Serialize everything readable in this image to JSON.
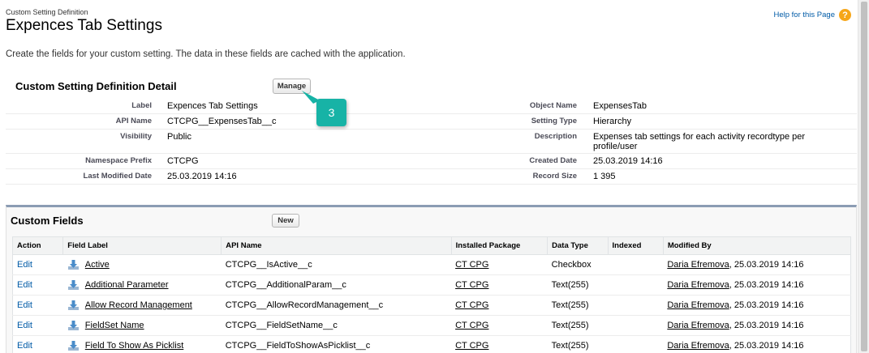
{
  "header": {
    "breadcrumb": "Custom Setting Definition",
    "title": "Expences Tab Settings",
    "help_link": "Help for this Page",
    "help_icon": "question-icon"
  },
  "description": "Create the fields for your custom setting. The data in these fields are cached with the application.",
  "detail": {
    "title": "Custom Setting Definition Detail",
    "manage_label": "Manage",
    "badge": "3",
    "rows": [
      {
        "l1": "Label",
        "v1": "Expences Tab Settings",
        "l2": "Object Name",
        "v2": "ExpensesTab"
      },
      {
        "l1": "API Name",
        "v1": "CTCPG__ExpensesTab__c",
        "l2": "Setting Type",
        "v2": "Hierarchy"
      },
      {
        "l1": "Visibility",
        "v1": "Public",
        "l2": "Description",
        "v2": "Expenses tab settings for each activity recordtype per profile/user"
      },
      {
        "l1": "Namespace Prefix",
        "v1": "CTCPG",
        "l2": "Created Date",
        "v2": "25.03.2019 14:16"
      },
      {
        "l1": "Last Modified Date",
        "v1": "25.03.2019 14:16",
        "l2": "Record Size",
        "v2": "1 395"
      }
    ]
  },
  "custom_fields": {
    "title": "Custom Fields",
    "new_label": "New",
    "columns": [
      "Action",
      "Field Label",
      "API Name",
      "Installed Package",
      "Data Type",
      "Indexed",
      "Modified By"
    ],
    "rows": [
      {
        "action": "Edit",
        "label": "Active",
        "api": "CTCPG__IsActive__c",
        "package": "CT CPG",
        "type": "Checkbox",
        "indexed": "",
        "modified_by": "Daria Efremova",
        "modified_date": ", 25.03.2019 14:16"
      },
      {
        "action": "Edit",
        "label": "Additional Parameter",
        "api": "CTCPG__AdditionalParam__c",
        "package": "CT CPG",
        "type": "Text(255)",
        "indexed": "",
        "modified_by": "Daria Efremova",
        "modified_date": ", 25.03.2019 14:16"
      },
      {
        "action": "Edit",
        "label": "Allow Record Management",
        "api": "CTCPG__AllowRecordManagement__c",
        "package": "CT CPG",
        "type": "Text(255)",
        "indexed": "",
        "modified_by": "Daria Efremova",
        "modified_date": ", 25.03.2019 14:16"
      },
      {
        "action": "Edit",
        "label": "FieldSet Name",
        "api": "CTCPG__FieldSetName__c",
        "package": "CT CPG",
        "type": "Text(255)",
        "indexed": "",
        "modified_by": "Daria Efremova",
        "modified_date": ", 25.03.2019 14:16"
      },
      {
        "action": "Edit",
        "label": "Field To Show As Picklist",
        "api": "CTCPG__FieldToShowAsPicklist__c",
        "package": "CT CPG",
        "type": "Text(255)",
        "indexed": "",
        "modified_by": "Daria Efremova",
        "modified_date": ", 25.03.2019 14:16"
      }
    ]
  }
}
